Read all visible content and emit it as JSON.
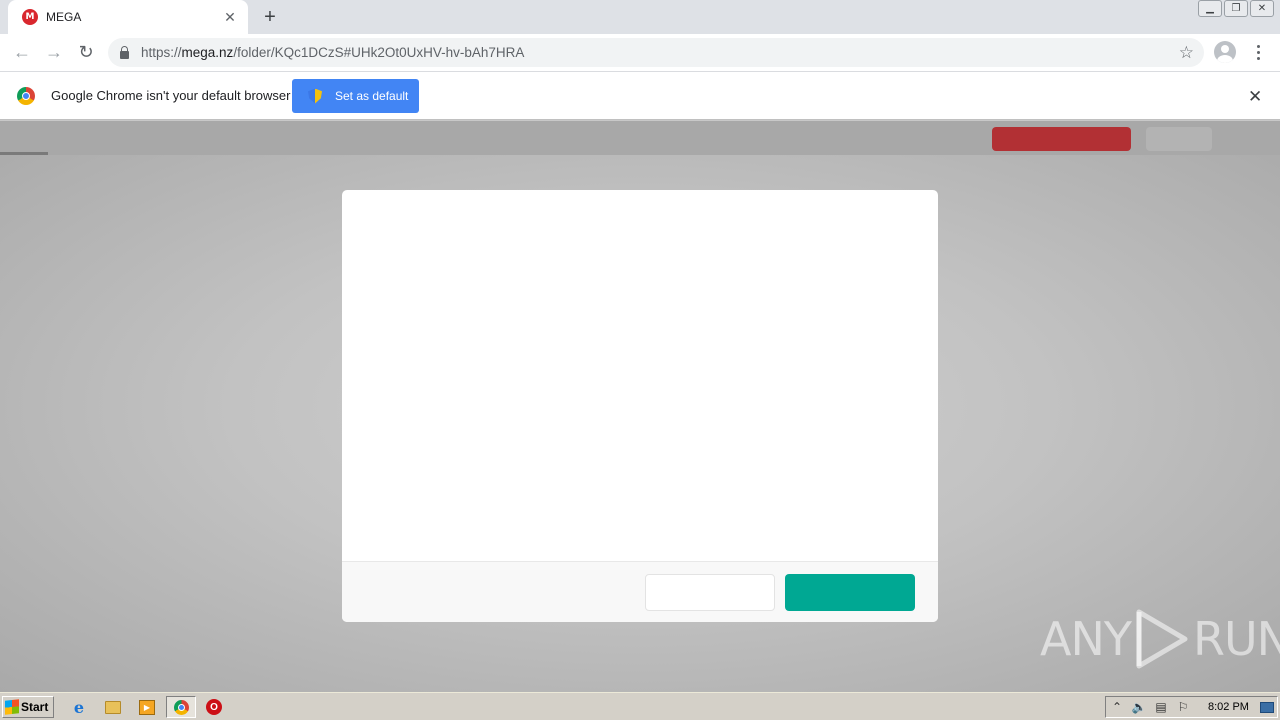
{
  "browser": {
    "tab": {
      "title": "MEGA",
      "favicon_letter": "M",
      "favicon_color": "#d9272e"
    },
    "new_tab_icon": "+",
    "window_controls": [
      "minimize-icon",
      "restore-icon",
      "close-icon"
    ],
    "address": {
      "scheme": "https://",
      "host": "mega.nz",
      "path": "/folder/KQc1DCzS#UHk2Ot0UxHV-hv-bAh7HRA"
    },
    "icons": [
      "back-icon",
      "forward-icon",
      "reload-icon",
      "lock-icon",
      "bookmark-star-icon",
      "profile-icon",
      "menu-icon"
    ]
  },
  "infobar": {
    "message": "Google Chrome isn't your default browser",
    "button_label": "Set as default",
    "button_color": "#4285f4"
  },
  "dialog": {
    "confirm_color": "#00a893"
  },
  "watermark": {
    "left": "ANY",
    "right": "RUN"
  },
  "taskbar": {
    "start_label": "Start",
    "apps": [
      "internet-explorer-icon",
      "windows-explorer-icon",
      "media-player-icon",
      "chrome-icon",
      "opera-icon"
    ],
    "clock": "8:02 PM"
  }
}
